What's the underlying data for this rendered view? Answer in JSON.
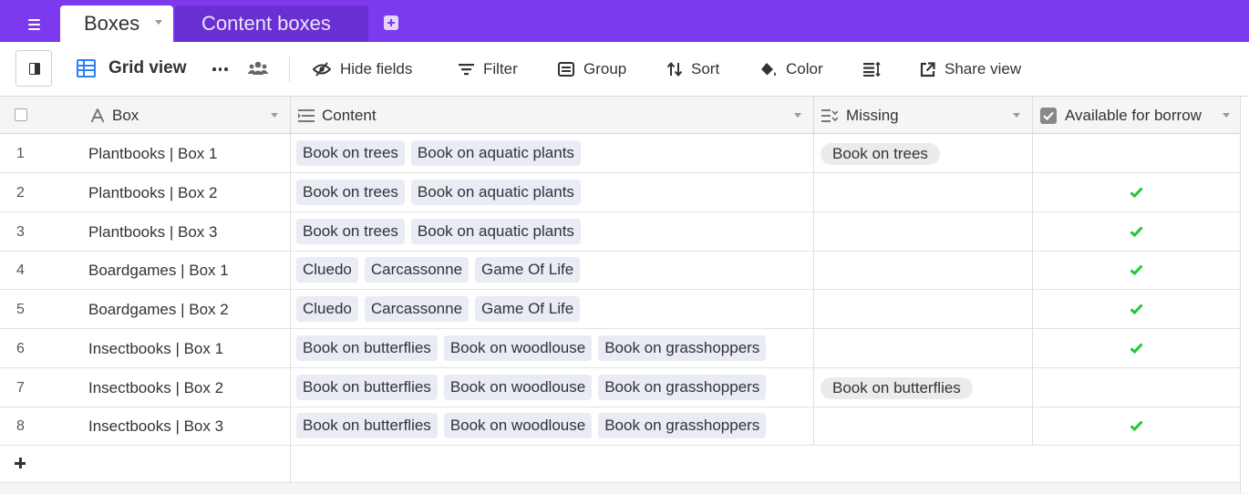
{
  "tabs": [
    {
      "label": "Boxes",
      "active": true
    },
    {
      "label": "Content boxes",
      "active": false
    }
  ],
  "toolbar": {
    "view_name": "Grid view",
    "hide_fields": "Hide fields",
    "filter": "Filter",
    "group": "Group",
    "sort": "Sort",
    "color": "Color",
    "share_view": "Share view"
  },
  "columns": [
    {
      "label": "Box",
      "icon": "text-field-icon"
    },
    {
      "label": "Content",
      "icon": "linked-list-icon"
    },
    {
      "label": "Missing",
      "icon": "multi-select-icon"
    },
    {
      "label": "Available for borrow",
      "icon": "checkbox-field-icon"
    }
  ],
  "rows": [
    {
      "num": "1",
      "box": "Plantbooks | Box 1",
      "content": [
        "Book on trees",
        "Book on aquatic plants"
      ],
      "missing": "Book on trees",
      "available": false
    },
    {
      "num": "2",
      "box": "Plantbooks | Box 2",
      "content": [
        "Book on trees",
        "Book on aquatic plants"
      ],
      "missing": "",
      "available": true
    },
    {
      "num": "3",
      "box": "Plantbooks | Box 3",
      "content": [
        "Book on trees",
        "Book on aquatic plants"
      ],
      "missing": "",
      "available": true
    },
    {
      "num": "4",
      "box": "Boardgames | Box 1",
      "content": [
        "Cluedo",
        "Carcassonne",
        "Game Of Life"
      ],
      "missing": "",
      "available": true
    },
    {
      "num": "5",
      "box": "Boardgames | Box 2",
      "content": [
        "Cluedo",
        "Carcassonne",
        "Game Of Life"
      ],
      "missing": "",
      "available": true
    },
    {
      "num": "6",
      "box": "Insectbooks | Box 1",
      "content": [
        "Book on butterflies",
        "Book on woodlouse",
        "Book on grasshoppers"
      ],
      "missing": "",
      "available": true
    },
    {
      "num": "7",
      "box": "Insectbooks | Box 2",
      "content": [
        "Book on butterflies",
        "Book on woodlouse",
        "Book on grasshoppers"
      ],
      "missing": "Book on butterflies",
      "available": false
    },
    {
      "num": "8",
      "box": "Insectbooks | Box 3",
      "content": [
        "Book on butterflies",
        "Book on woodlouse",
        "Book on grasshoppers"
      ],
      "missing": "",
      "available": true
    }
  ],
  "colors": {
    "brand": "#7c39ed",
    "grid_icon": "#2d7ff9",
    "check": "#20c933"
  }
}
